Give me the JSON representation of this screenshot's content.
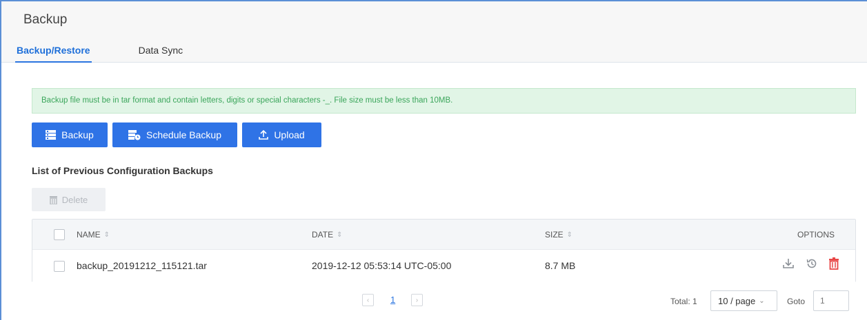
{
  "header": {
    "title": "Backup",
    "tabs": [
      {
        "label": "Backup/Restore",
        "active": true
      },
      {
        "label": "Data Sync",
        "active": false
      }
    ]
  },
  "notice": "Backup file must be in tar format and contain letters, digits or special characters -_. File size must be less than 10MB.",
  "actions": {
    "backup_label": "Backup",
    "schedule_label": "Schedule Backup",
    "upload_label": "Upload"
  },
  "list": {
    "title": "List of Previous Configuration Backups",
    "delete_label": "Delete",
    "columns": {
      "name": "NAME",
      "date": "DATE",
      "size": "SIZE",
      "options": "OPTIONS"
    },
    "rows": [
      {
        "name": "backup_20191212_115121.tar",
        "date": "2019-12-12 05:53:14 UTC-05:00",
        "size": "8.7 MB"
      }
    ]
  },
  "pagination": {
    "current_page": "1",
    "total_label": "Total: 1",
    "page_size": "10 / page",
    "goto_label": "Goto",
    "goto_value": "1"
  },
  "colors": {
    "primary": "#2f73e6",
    "notice_bg": "#e1f5e6",
    "notice_text": "#3aa55a",
    "danger": "#e84646"
  },
  "icons": {
    "backup": "server-list-icon",
    "schedule": "schedule-server-icon",
    "upload": "upload-icon",
    "delete": "trash-icon",
    "download": "download-icon",
    "restore": "restore-icon",
    "remove": "trash-icon"
  }
}
